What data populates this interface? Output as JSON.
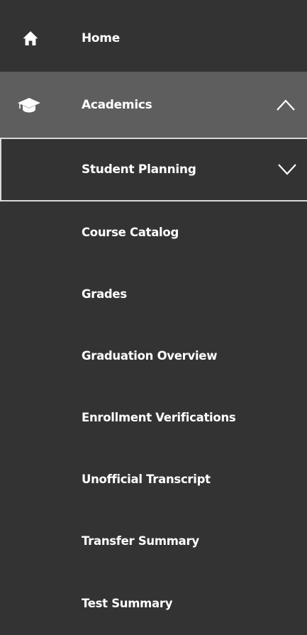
{
  "nav": {
    "home": {
      "label": "Home",
      "icon": "home-icon"
    },
    "academics": {
      "label": "Academics",
      "icon": "graduation-cap-icon",
      "expanded": true
    },
    "student_planning": {
      "label": "Student Planning",
      "icon": "chevron-down-icon",
      "expanded": false
    },
    "items": [
      {
        "label": "Course Catalog"
      },
      {
        "label": "Grades"
      },
      {
        "label": "Graduation Overview"
      },
      {
        "label": "Enrollment Verifications"
      },
      {
        "label": "Unofficial Transcript"
      },
      {
        "label": "Transfer Summary"
      },
      {
        "label": "Test Summary"
      }
    ]
  },
  "colors": {
    "background": "#333333",
    "active_row": "#5e5e5e",
    "text": "#ffffff",
    "border": "#d9d9d9"
  }
}
